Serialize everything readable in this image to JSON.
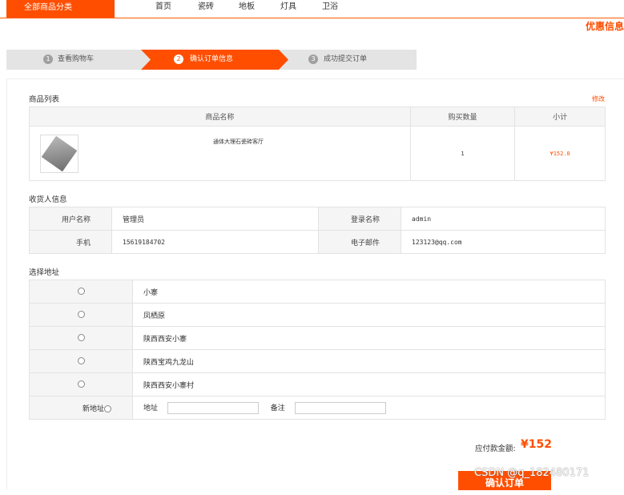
{
  "topbar": {
    "category_button": "全部商品分类",
    "nav": [
      "首页",
      "瓷砖",
      "地板",
      "灯具",
      "卫浴"
    ],
    "promo": "优惠信息"
  },
  "steps": [
    {
      "num": "1",
      "label": "查看购物车",
      "state": "done"
    },
    {
      "num": "2",
      "label": "确认订单信息",
      "state": "active"
    },
    {
      "num": "3",
      "label": "成功提交订单",
      "state": "pending"
    }
  ],
  "goods": {
    "title": "商品列表",
    "edit": "修改",
    "headers": [
      "商品名称",
      "购买数量",
      "小计"
    ],
    "rows": [
      {
        "name": "通体大理石瓷砖客厅",
        "qty": "1",
        "subtotal": "¥152.0"
      }
    ]
  },
  "receiver": {
    "title": "收货人信息",
    "user_label": "用户名称",
    "user_value": "管理员",
    "login_label": "登录名称",
    "login_value": "admin",
    "phone_label": "手机",
    "phone_value": "15619184702",
    "email_label": "电子邮件",
    "email_value": "123123@qq.com"
  },
  "address": {
    "title": "选择地址",
    "options": [
      "小寨",
      "凤栖原",
      "陕西西安小寨",
      "陕西宝鸡九龙山",
      "陕西西安小寨村"
    ],
    "new_label": "新地址",
    "addr_label": "地址",
    "note_label": "备注"
  },
  "total": {
    "label": "应付款金额:",
    "value": "¥152"
  },
  "confirm_button": "确认订单",
  "watermark": "CSDN @q_182480171",
  "colors": {
    "accent": "#ff4e00",
    "step_gray": "#e4e4e4"
  }
}
